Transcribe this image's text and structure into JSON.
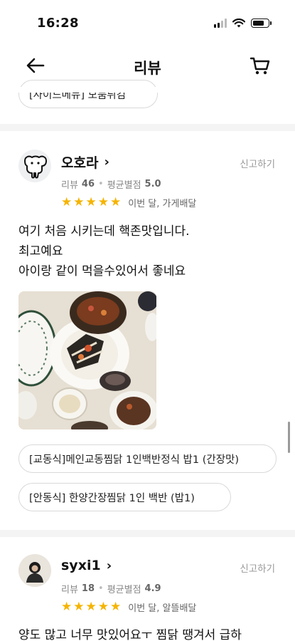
{
  "status_bar": {
    "time": "16:28"
  },
  "header": {
    "title": "리뷰"
  },
  "top_chip": {
    "label": "[사이드메뉴] 모둠튀김"
  },
  "reviews": [
    {
      "name": "오호라",
      "chevron": "›",
      "report": "신고하기",
      "review_label": "리뷰",
      "review_count": "46",
      "rating_label": "평균별점",
      "avg_rating": "5.0",
      "stars": 5,
      "meta": "이번 달, 가게배달",
      "text_lines": [
        "여기 처음 시키는데 핵존맛입니다.",
        "최고예요",
        "아이랑 같이 먹을수있어서 좋네요"
      ],
      "menus": [
        "[교동식]메인교동찜닭 1인백반정식 밥1 (간장맛)",
        "[안동식] 한양간장찜닭 1인 백반 (밥1)"
      ]
    },
    {
      "name": "syxi1",
      "chevron": "›",
      "report": "신고하기",
      "review_label": "리뷰",
      "review_count": "18",
      "rating_label": "평균별점",
      "avg_rating": "4.9",
      "stars": 5,
      "meta": "이번 달, 알뜰배달",
      "text_lines": [
        "양도 많고 너무 맛있어요ㅜ 찜닭 땡겨서 급하"
      ]
    }
  ],
  "star_glyph": "★",
  "colors": {
    "star": "#f5b400",
    "muted": "#888888"
  }
}
